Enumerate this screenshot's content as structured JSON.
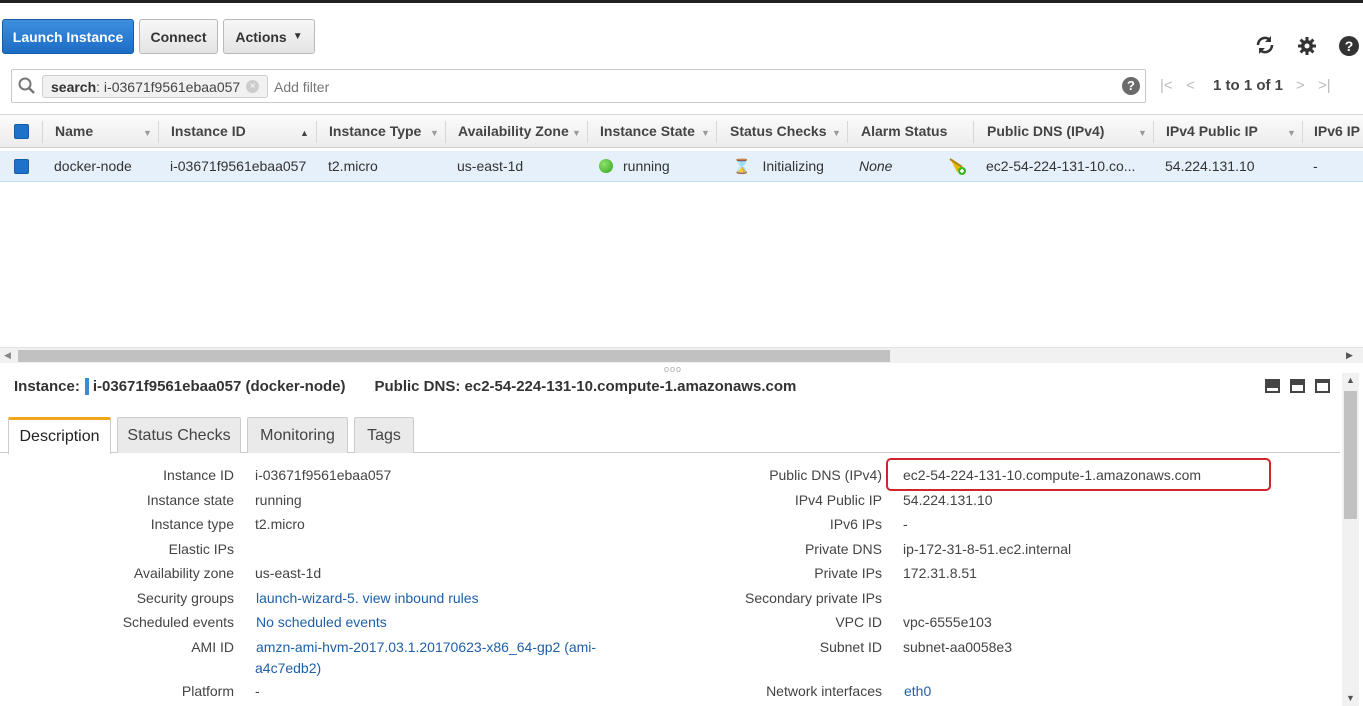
{
  "toolbar": {
    "launch_label": "Launch Instance",
    "connect_label": "Connect",
    "actions_label": "Actions"
  },
  "search": {
    "token_key": "search",
    "token_value": ": i-03671f9561ebaa057",
    "placeholder": "Add filter"
  },
  "pager": {
    "text": "1 to 1 of 1"
  },
  "grid": {
    "columns": [
      "Name",
      "Instance ID",
      "Instance Type",
      "Availability Zone",
      "Instance State",
      "Status Checks",
      "Alarm Status",
      "Public DNS (IPv4)",
      "IPv4 Public IP",
      "IPv6 IP"
    ],
    "row": {
      "name": "docker-node",
      "instance_id": "i-03671f9561ebaa057",
      "instance_type": "t2.micro",
      "az": "us-east-1d",
      "state": "running",
      "status_checks": "Initializing",
      "alarm_status": "None",
      "public_dns": "ec2-54-224-131-10.co...",
      "ipv4": "54.224.131.10",
      "ipv6": "-"
    }
  },
  "detail": {
    "instance_prefix": "Instance:",
    "instance_text": "i-03671f9561ebaa057 (docker-node)",
    "public_dns_title": "Public DNS: ec2-54-224-131-10.compute-1.amazonaws.com",
    "tabs": [
      "Description",
      "Status Checks",
      "Monitoring",
      "Tags"
    ],
    "left": [
      {
        "label": "Instance ID",
        "value": "i-03671f9561ebaa057"
      },
      {
        "label": "Instance state",
        "value": "running"
      },
      {
        "label": "Instance type",
        "value": "t2.micro"
      },
      {
        "label": "Elastic IPs",
        "value": ""
      },
      {
        "label": "Availability zone",
        "value": "us-east-1d"
      },
      {
        "label": "Security groups",
        "value": "launch-wizard-5",
        "value2": ". view inbound rules"
      },
      {
        "label": "Scheduled events",
        "value": "No scheduled events"
      },
      {
        "label": "AMI ID",
        "value": "amzn-ami-hvm-2017.03.1.20170623-x86_64-gp2 (ami-",
        "value_line2": "a4c7edb2)"
      },
      {
        "label": "Platform",
        "value": "-"
      }
    ],
    "right": [
      {
        "label": "Public DNS (IPv4)",
        "value": "ec2-54-224-131-10.compute-1.amazonaws.com"
      },
      {
        "label": "IPv4 Public IP",
        "value": "54.224.131.10"
      },
      {
        "label": "IPv6 IPs",
        "value": "-"
      },
      {
        "label": "Private DNS",
        "value": "ip-172-31-8-51.ec2.internal"
      },
      {
        "label": "Private IPs",
        "value": "172.31.8.51"
      },
      {
        "label": "Secondary private IPs",
        "value": ""
      },
      {
        "label": "VPC ID",
        "value": "vpc-6555e103"
      },
      {
        "label": "Subnet ID",
        "value": "subnet-aa0058e3"
      },
      {
        "label": "Network interfaces",
        "value": "eth0"
      }
    ]
  },
  "colors": {
    "primary": "#1b6cc4",
    "running": "#3cb521",
    "highlight": "#d0252d",
    "tab_accent": "#f0a71b",
    "link": "#1e5fa8"
  },
  "icons": [
    "refresh-icon",
    "gear-icon",
    "help-icon",
    "search-icon",
    "hourglass-icon",
    "alarm-bell-icon"
  ]
}
